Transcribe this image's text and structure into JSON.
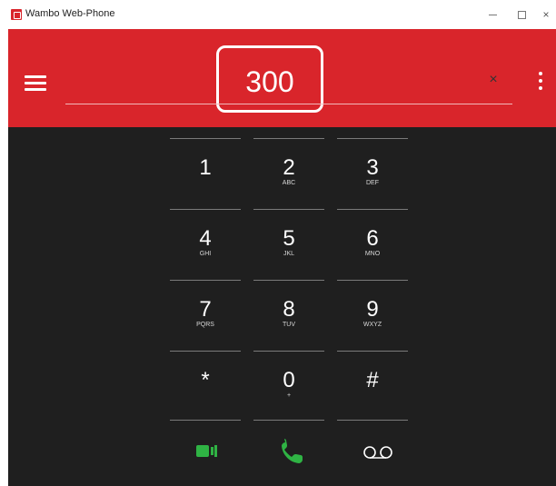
{
  "window": {
    "title": "Wambo Web-Phone",
    "minimize_glyph": "",
    "maximize_glyph": "",
    "close_glyph": "×"
  },
  "header": {
    "dialed_number": "300",
    "clear_glyph": "×",
    "accent_color": "#d9252b"
  },
  "keypad": {
    "keys": [
      {
        "digit": "1",
        "letters": ""
      },
      {
        "digit": "2",
        "letters": "ABC"
      },
      {
        "digit": "3",
        "letters": "DEF"
      },
      {
        "digit": "4",
        "letters": "GHI"
      },
      {
        "digit": "5",
        "letters": "JKL"
      },
      {
        "digit": "6",
        "letters": "MNO"
      },
      {
        "digit": "7",
        "letters": "PQRS"
      },
      {
        "digit": "8",
        "letters": "TUV"
      },
      {
        "digit": "9",
        "letters": "WXYZ"
      },
      {
        "digit": "*",
        "letters": ""
      },
      {
        "digit": "0",
        "letters": "+"
      },
      {
        "digit": "#",
        "letters": ""
      }
    ]
  },
  "actions": {
    "video_icon": "video-camera-icon",
    "call_icon": "phone-icon",
    "voicemail_icon": "voicemail-icon",
    "call_color": "#2fb344"
  }
}
